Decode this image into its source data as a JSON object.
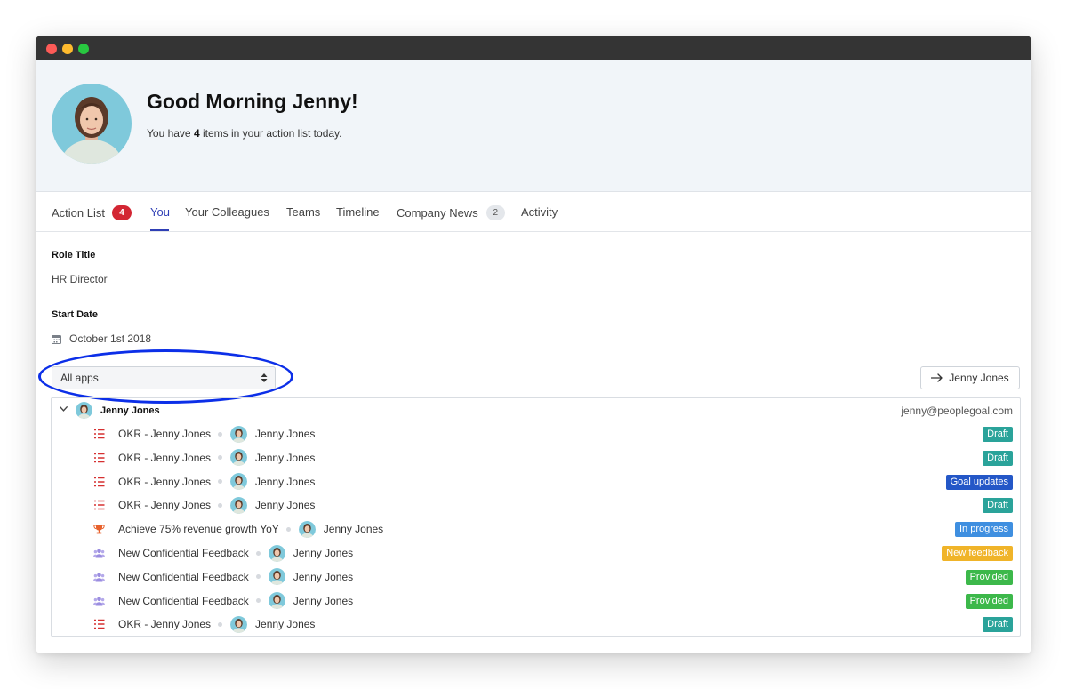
{
  "header": {
    "greeting": "Good Morning Jenny!",
    "subtitle_prefix": "You have ",
    "subtitle_count": "4",
    "subtitle_suffix": " items in your action list today."
  },
  "tabs": [
    {
      "label": "Action List",
      "badge": "4"
    },
    {
      "label": "You"
    },
    {
      "label": "Your Colleagues"
    },
    {
      "label": "Teams"
    },
    {
      "label": "Timeline"
    },
    {
      "label": "Company News",
      "badge": "2"
    },
    {
      "label": "Activity"
    }
  ],
  "profile": {
    "role_label": "Role Title",
    "role_value": "HR Director",
    "start_label": "Start Date",
    "start_value": "October 1st 2018"
  },
  "filter": {
    "selected": "All apps"
  },
  "person_button": {
    "label": "Jenny Jones"
  },
  "list": {
    "owner_name": "Jenny Jones",
    "owner_email": "jenny@peoplegoal.com",
    "rows": [
      {
        "icon": "checklist-icon",
        "title": "OKR - Jenny Jones",
        "person": "Jenny Jones",
        "status": "Draft",
        "status_color": "#2aa39a"
      },
      {
        "icon": "checklist-icon",
        "title": "OKR - Jenny Jones",
        "person": "Jenny Jones",
        "status": "Draft",
        "status_color": "#2aa39a"
      },
      {
        "icon": "checklist-icon",
        "title": "OKR - Jenny Jones",
        "person": "Jenny Jones",
        "status": "Goal updates",
        "status_color": "#2457c7"
      },
      {
        "icon": "checklist-icon",
        "title": "OKR - Jenny Jones",
        "person": "Jenny Jones",
        "status": "Draft",
        "status_color": "#2aa39a"
      },
      {
        "icon": "trophy-icon",
        "title": "Achieve 75% revenue growth YoY",
        "person": "Jenny Jones",
        "status": "In progress",
        "status_color": "#3f8fe0"
      },
      {
        "icon": "people-icon",
        "title": "New Confidential Feedback",
        "person": "Jenny Jones",
        "status": "New feedback",
        "status_color": "#f0b429"
      },
      {
        "icon": "people-icon",
        "title": "New Confidential Feedback",
        "person": "Jenny Jones",
        "status": "Provided",
        "status_color": "#3cb84a"
      },
      {
        "icon": "people-icon",
        "title": "New Confidential Feedback",
        "person": "Jenny Jones",
        "status": "Provided",
        "status_color": "#3cb84a"
      },
      {
        "icon": "checklist-icon",
        "title": "OKR - Jenny Jones",
        "person": "Jenny Jones",
        "status": "Draft",
        "status_color": "#2aa39a"
      }
    ]
  },
  "colors": {
    "accent": "#2f3fb5",
    "badge_red": "#d32633",
    "highlight_ring": "#0c2fe8"
  }
}
